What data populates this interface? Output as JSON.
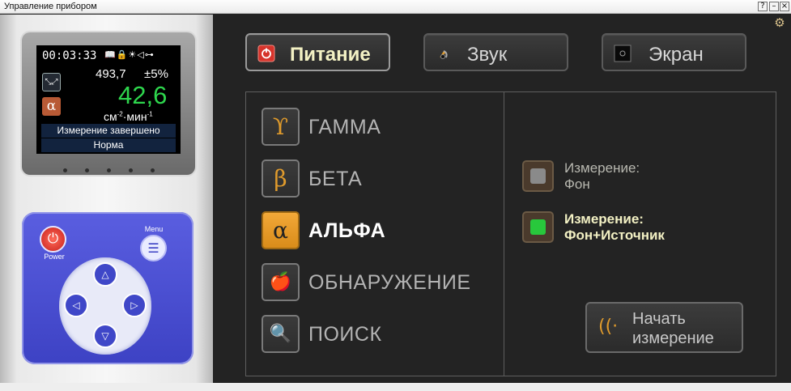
{
  "window": {
    "title": "Управление прибором",
    "help_label": "?",
    "minimize_label": "–",
    "close_label": "×"
  },
  "device": {
    "lcd": {
      "time": "00:03:33",
      "status_icons": "📖🔒☀◁⊶",
      "count": "493,7",
      "error": "±5%",
      "value": "42,6",
      "unit_base": "см",
      "unit_exp1": "-2",
      "unit_mid": "·мин",
      "unit_exp2": "-1",
      "message": "Измерение завершено",
      "status": "Норма",
      "mode_symbol": "α"
    },
    "keypad": {
      "power_label": "Power",
      "menu_label": "Menu"
    }
  },
  "top_buttons": {
    "power": "Питание",
    "sound": "Звук",
    "screen": "Экран"
  },
  "modes": [
    {
      "symbol": "ϒ",
      "label": "ГАММА",
      "active": false
    },
    {
      "symbol": "β",
      "label": "БЕТА",
      "active": false
    },
    {
      "symbol": "α",
      "label": "АЛЬФА",
      "active": true
    },
    {
      "symbol": "🍎",
      "label": "ОБНАРУЖЕНИЕ",
      "active": false
    },
    {
      "symbol": "🔍",
      "label": "ПОИСК",
      "active": false
    }
  ],
  "measurement_options": [
    {
      "line1": "Измерение:",
      "line2": "Фон",
      "active": false
    },
    {
      "line1": "Измерение:",
      "line2": "Фон+Источник",
      "active": true
    }
  ],
  "start_button": {
    "line1": "Начать",
    "line2": "измерение"
  },
  "colors": {
    "accent_orange": "#e09b2c",
    "lcd_green": "#2ed64d",
    "indicator_green": "#28c83c",
    "indicator_gray": "#8a8a8a",
    "power_red": "#d6332b"
  }
}
